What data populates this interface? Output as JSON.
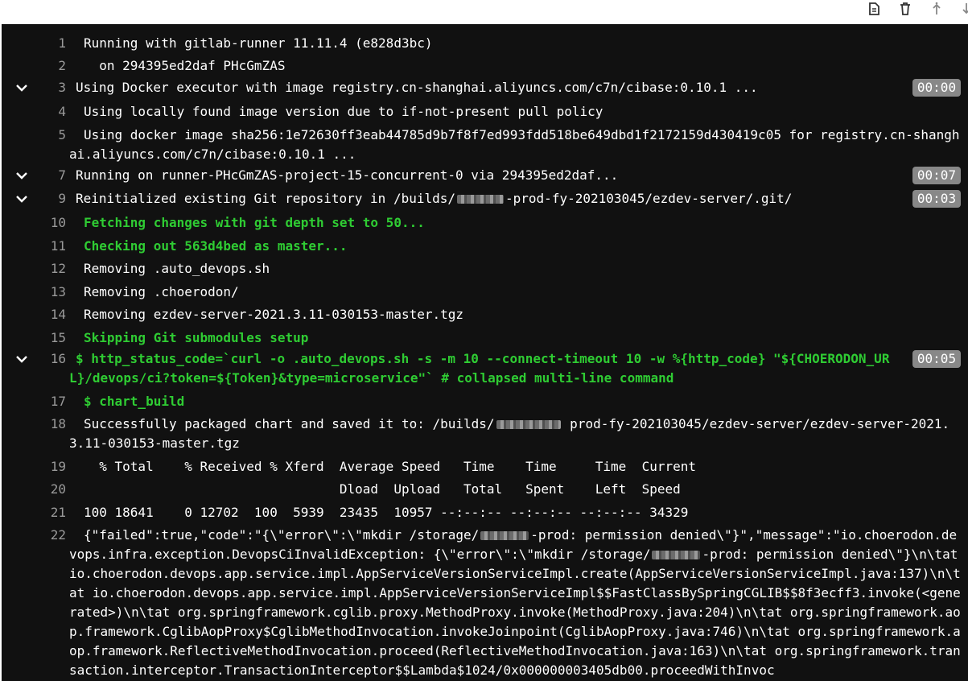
{
  "toolbar": {
    "icons": [
      "document-icon",
      "trash-icon",
      "scroll-top-icon",
      "scroll-bottom-icon"
    ]
  },
  "colors": {
    "background": "#111111",
    "text": "#ffffff",
    "green": "#2fcc33",
    "line_number": "#9a9a9a",
    "duration_badge": "#888888"
  },
  "log": [
    {
      "num": "1",
      "text": "Running with gitlab-runner 11.11.4 (e828d3bc)"
    },
    {
      "num": "2",
      "text": "  on 294395ed2daf PHcGmZAS"
    },
    {
      "num": "3",
      "text": "Using Docker executor with image registry.cn-shanghai.aliyuncs.com/c7n/cibase:0.10.1 ...",
      "duration": "00:00"
    },
    {
      "num": "4",
      "text": "Using locally found image version due to if-not-present pull policy"
    },
    {
      "num": "5",
      "text": "Using docker image sha256:1e72630ff3eab44785d9b7f8f7ed993fdd518be649dbd1f2172159d430419c05 for registry.cn-shanghai.aliyuncs.com/c7n/cibase:0.10.1 ..."
    },
    {
      "num": "7",
      "text": "Running on runner-PHcGmZAS-project-15-concurrent-0 via 294395ed2daf...",
      "duration": "00:07"
    },
    {
      "num": "9",
      "text_before": "Reinitialized existing Git repository in /builds/",
      "text_after": "-prod-fy-202103045/ezdev-server/.git/",
      "duration": "00:03"
    },
    {
      "num": "10",
      "text": "Fetching changes with git depth set to 50..."
    },
    {
      "num": "11",
      "text": "Checking out 563d4bed as master..."
    },
    {
      "num": "12",
      "text": "Removing .auto_devops.sh"
    },
    {
      "num": "13",
      "text": "Removing .choerodon/"
    },
    {
      "num": "14",
      "text": "Removing ezdev-server-2021.3.11-030153-master.tgz"
    },
    {
      "num": "15",
      "text": "Skipping Git submodules setup"
    },
    {
      "num": "16",
      "text": "$ http_status_code=`curl -o .auto_devops.sh -s -m 10 --connect-timeout 10 -w %{http_code} \"${CHOERODON_URL}/devops/ci?token=${Token}&type=microservice\"` # collapsed multi-line command",
      "duration": "00:05"
    },
    {
      "num": "17",
      "text": "$ chart_build"
    },
    {
      "num": "18",
      "text_before": "Successfully packaged chart and saved it to: /builds/",
      "text_after": " prod-fy-202103045/ezdev-server/ezdev-server-2021.3.11-030153-master.tgz"
    },
    {
      "num": "19",
      "text": "  % Total    % Received % Xferd  Average Speed   Time    Time     Time  Current"
    },
    {
      "num": "20",
      "text": "                                 Dload  Upload   Total   Spent    Left  Speed"
    },
    {
      "num": "21",
      "text": "100 18641    0 12702  100  5939  23435  10957 --:--:-- --:--:-- --:--:-- 34329"
    },
    {
      "num": "22",
      "text_before": "{\"failed\":true,\"code\":\"{\\\"error\\\":\\\"mkdir /storage/",
      "text_mid": "-prod: permission denied\\\"}\",\"message\":\"io.choerodon.devops.infra.exception.DevopsCiInvalidException: {\\\"error\\\":\\\"mkdir /storage/",
      "text_after": "-prod: permission denied\\\"}\\n\\tat io.choerodon.devops.app.service.impl.AppServiceVersionServiceImpl.create(AppServiceVersionServiceImpl.java:137)\\n\\tat io.choerodon.devops.app.service.impl.AppServiceVersionServiceImpl$$FastClassBySpringCGLIB$$8f3ecff3.invoke(<generated>)\\n\\tat org.springframework.cglib.proxy.MethodProxy.invoke(MethodProxy.java:204)\\n\\tat org.springframework.aop.framework.CglibAopProxy$CglibMethodInvocation.invokeJoinpoint(CglibAopProxy.java:746)\\n\\tat org.springframework.aop.framework.ReflectiveMethodInvocation.proceed(ReflectiveMethodInvocation.java:163)\\n\\tat org.springframework.transaction.interceptor.TransactionInterceptor$$Lambda$1024/0x000000003405db00.proceedWithInvoc"
    }
  ]
}
